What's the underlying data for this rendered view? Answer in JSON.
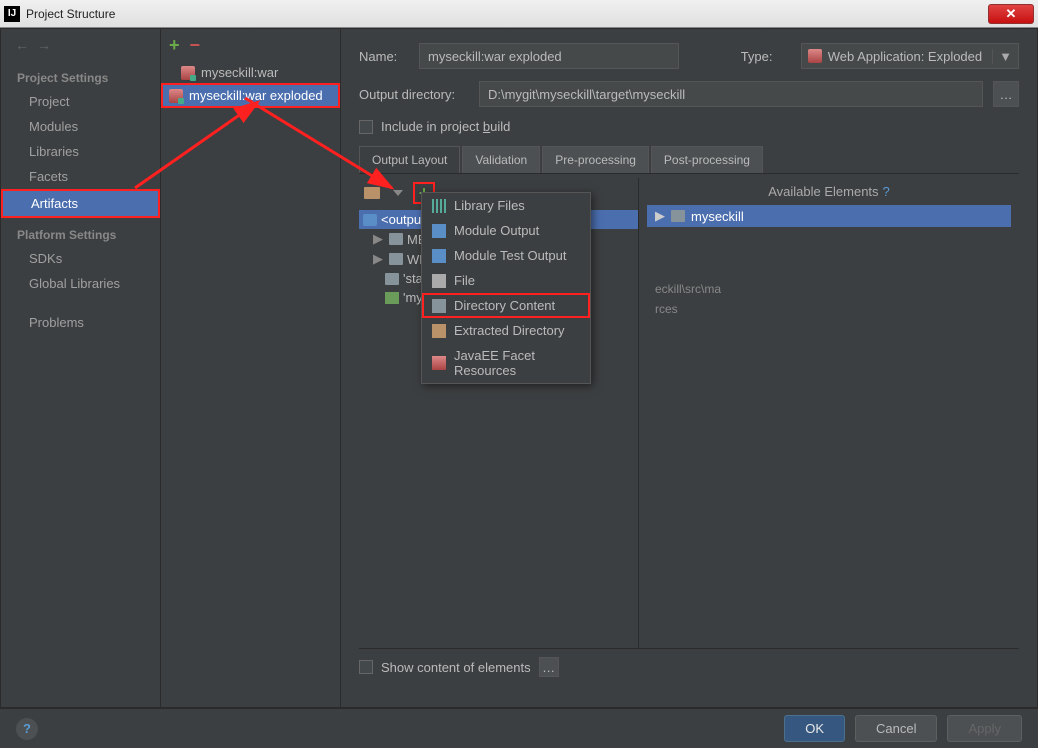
{
  "window": {
    "title": "Project Structure"
  },
  "sidebar": {
    "sections": [
      {
        "header": "Project Settings",
        "items": [
          "Project",
          "Modules",
          "Libraries",
          "Facets",
          "Artifacts"
        ]
      },
      {
        "header": "Platform Settings",
        "items": [
          "SDKs",
          "Global Libraries"
        ]
      }
    ],
    "extra": "Problems",
    "selected": "Artifacts"
  },
  "artifacts": {
    "items": [
      {
        "label": "myseckill:war"
      },
      {
        "label": "myseckill:war exploded",
        "selected": true
      }
    ]
  },
  "form": {
    "name_label": "Name:",
    "name_value": "myseckill:war exploded",
    "type_label": "Type:",
    "type_value": "Web Application: Exploded",
    "output_dir_label": "Output directory:",
    "output_dir_value": "D:\\mygit\\myseckill\\target\\myseckill",
    "include_label_pre": "Include in project ",
    "include_label_u": "b",
    "include_label_post": "uild"
  },
  "tabs": [
    "Output Layout",
    "Validation",
    "Pre-processing",
    "Post-processing"
  ],
  "tree": {
    "root": "<output root>",
    "items": [
      "META-INF",
      "WEB-INF",
      "'static' directory contents",
      "'myseckill' compile output"
    ],
    "truncated": [
      "META",
      "WEB-",
      "'stat",
      "'mys"
    ]
  },
  "popup": {
    "items": [
      "Library Files",
      "Module Output",
      "Module Test Output",
      "File",
      "Directory Content",
      "Extracted Directory",
      "JavaEE Facet Resources"
    ],
    "highlighted": "Directory Content"
  },
  "available": {
    "header": "Available Elements",
    "item": "myseckill",
    "path1": "eckill\\src\\ma",
    "path2": "rces"
  },
  "show_content": "Show content of elements",
  "footer": {
    "ok": "OK",
    "cancel": "Cancel",
    "apply": "Apply"
  }
}
